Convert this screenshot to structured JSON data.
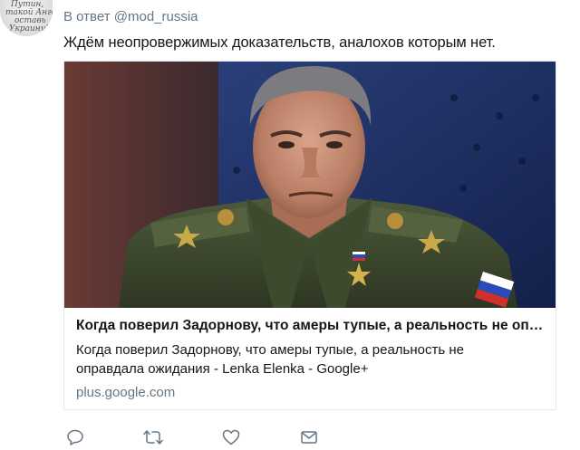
{
  "tweet": {
    "avatar_alt": "avatar",
    "avatar_scribble": [
      "Путин,",
      "такой Ангел",
      "оставь",
      "Украину!"
    ],
    "reply_prefix": "В ответ",
    "reply_handle": "@mod_russia",
    "text": "Ждём неопровержимых доказательств, аналохов которым нет."
  },
  "card": {
    "title": "Когда поверил Задорнову, что амеры тупые, а реальность не оп…",
    "description": "Когда поверил Задорнову, что амеры тупые, а реальность не оправдала ожидания - Lenka Elenka - Google+",
    "domain": "plus.google.com"
  },
  "actions": [
    {
      "name": "reply-icon"
    },
    {
      "name": "retweet-icon"
    },
    {
      "name": "like-icon"
    },
    {
      "name": "direct-message-icon"
    }
  ],
  "colors": {
    "muted": "#657786",
    "text": "#14171a",
    "border": "#e1e8ed"
  }
}
